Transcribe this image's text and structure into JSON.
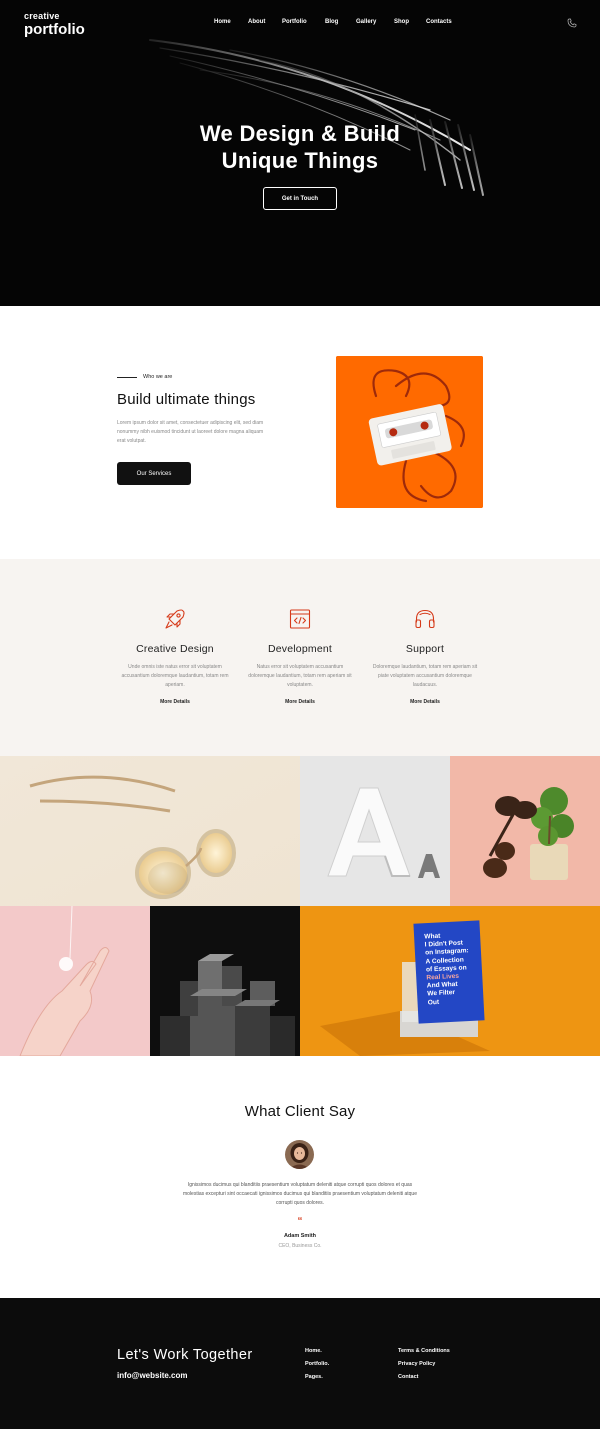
{
  "brand": {
    "line1": "creative",
    "line2": "portfolio"
  },
  "nav": {
    "items": [
      "Home",
      "About",
      "Portfolio",
      "Blog",
      "Gallery",
      "Shop",
      "Contacts"
    ],
    "phone_icon": "phone-icon"
  },
  "hero": {
    "title_line1": "We Design & Build",
    "title_line2": "Unique Things",
    "cta": "Get in Touch"
  },
  "about": {
    "eyebrow": "Who we are",
    "title": "Build ultimate things",
    "body": "Lorem ipsum dolor sit amet, consectetuer adipiscing elit, sed diam nonummy nibh euismod tincidunt ut laoreet dolore magna aliquam erat volutpat.",
    "button": "Our Services",
    "image": "cassette-tape-photo"
  },
  "services": [
    {
      "icon": "rocket-icon",
      "title": "Creative Design",
      "body": "Unde omnis iste natus error sit voluptatem accusantium doloremque laudantium, totam rem aperiam.",
      "link": "More Details"
    },
    {
      "icon": "code-window-icon",
      "title": "Development",
      "body": "Natus error sit voluptatem accusantium doloremque laudantium, totam rem aperiam sit voluptatem.",
      "link": "More Details"
    },
    {
      "icon": "headphones-icon",
      "title": "Support",
      "body": "Doloremque laudantium, totam rem aperiam sit piate voluptatem accusantium doloremque laudacuus.",
      "link": "More Details"
    }
  ],
  "gallery": {
    "book": {
      "lines": [
        "What",
        "I Didn't Post",
        "on Instagram:",
        "A Collection",
        "of Essays on",
        "Real Lives",
        "And What",
        "We Filter",
        "Out"
      ]
    }
  },
  "testimonial": {
    "title": "What Client Say",
    "body": "Ignissimos ducimus qui blanditiis praesentium voluptatum deleniti atque corrupti quos dolores et quas molestias excepturi sint occaecati ignissimos ducimus qui blanditiis praesentium voluptatum deleniti atque corrupti quos dolores.",
    "quote_mark": "“",
    "author": "Adam Smith",
    "role": "CEO, Business Co."
  },
  "footer": {
    "title": "Let's Work Together",
    "email": "info@website.com",
    "col1": [
      "Home.",
      "Portfolio.",
      "Pages."
    ],
    "col2": [
      "Terms & Conditions",
      "Privacy Policy",
      "Contact"
    ]
  },
  "colors": {
    "accent": "#d63a1a",
    "dark": "#0c0c0c",
    "services_bg": "#f7f4f1",
    "orange": "#ff6a00"
  }
}
